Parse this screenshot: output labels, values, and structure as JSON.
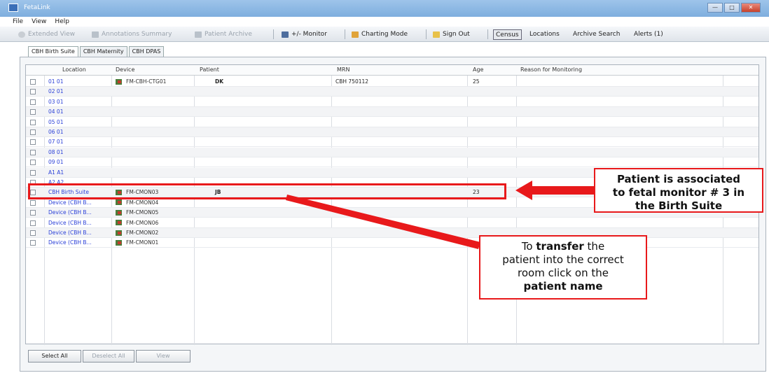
{
  "window": {
    "title": "FetaLink",
    "min": "—",
    "max": "□",
    "close": "✕"
  },
  "menu": [
    "File",
    "View",
    "Help"
  ],
  "toolbar": {
    "extended_view": "Extended View",
    "annotations_summary": "Annotations Summary",
    "patient_archive": "Patient Archive",
    "monitor": "+/- Monitor",
    "charting_mode": "Charting Mode",
    "sign_out": "Sign Out",
    "census": "Census",
    "locations": "Locations",
    "archive_search": "Archive Search",
    "alerts": "Alerts (1)"
  },
  "tabs": [
    "CBH Birth Suite",
    "CBH Maternity",
    "CBH DPAS"
  ],
  "columns": [
    "Location",
    "Device",
    "Patient",
    "MRN",
    "Age",
    "Reason for Monitoring"
  ],
  "rows": [
    {
      "location": "01 01",
      "device": "FM-CBH-CTG01",
      "patient": "DK",
      "mrn": "CBH 750112",
      "age": "25"
    },
    {
      "location": "02 01",
      "device": "",
      "patient": "",
      "mrn": "",
      "age": ""
    },
    {
      "location": "03 01",
      "device": "",
      "patient": "",
      "mrn": "",
      "age": ""
    },
    {
      "location": "04 01",
      "device": "",
      "patient": "",
      "mrn": "",
      "age": ""
    },
    {
      "location": "05 01",
      "device": "",
      "patient": "",
      "mrn": "",
      "age": ""
    },
    {
      "location": "06 01",
      "device": "",
      "patient": "",
      "mrn": "",
      "age": ""
    },
    {
      "location": "07 01",
      "device": "",
      "patient": "",
      "mrn": "",
      "age": ""
    },
    {
      "location": "08 01",
      "device": "",
      "patient": "",
      "mrn": "",
      "age": ""
    },
    {
      "location": "09 01",
      "device": "",
      "patient": "",
      "mrn": "",
      "age": ""
    },
    {
      "location": "A1 A1",
      "device": "",
      "patient": "",
      "mrn": "",
      "age": ""
    },
    {
      "location": "A2 A2",
      "device": "",
      "patient": "",
      "mrn": "",
      "age": ""
    },
    {
      "location": "CBH Birth Suite",
      "device": "FM-CMON03",
      "patient": "JB",
      "mrn": "",
      "age": "23"
    },
    {
      "location": "Device (CBH B...",
      "device": "FM-CMON04",
      "patient": "",
      "mrn": "",
      "age": ""
    },
    {
      "location": "Device (CBH B...",
      "device": "FM-CMON05",
      "patient": "",
      "mrn": "",
      "age": ""
    },
    {
      "location": "Device (CBH B...",
      "device": "FM-CMON06",
      "patient": "",
      "mrn": "",
      "age": ""
    },
    {
      "location": "Device (CBH B...",
      "device": "FM-CMON02",
      "patient": "",
      "mrn": "",
      "age": ""
    },
    {
      "location": "Device (CBH B...",
      "device": "FM-CMON01",
      "patient": "",
      "mrn": "",
      "age": ""
    }
  ],
  "buttons": {
    "select_all": "Select All",
    "deselect_all": "Deselect All",
    "view": "View"
  },
  "callouts": {
    "associated": [
      "Patient is associated",
      "to fetal monitor # 3 in",
      "the Birth Suite"
    ],
    "transfer": {
      "l1_a": "To ",
      "l1_b": "transfer",
      "l1_c": " the",
      "l2": "patient into the correct",
      "l3": "room click on the",
      "l4": "patient name"
    }
  }
}
